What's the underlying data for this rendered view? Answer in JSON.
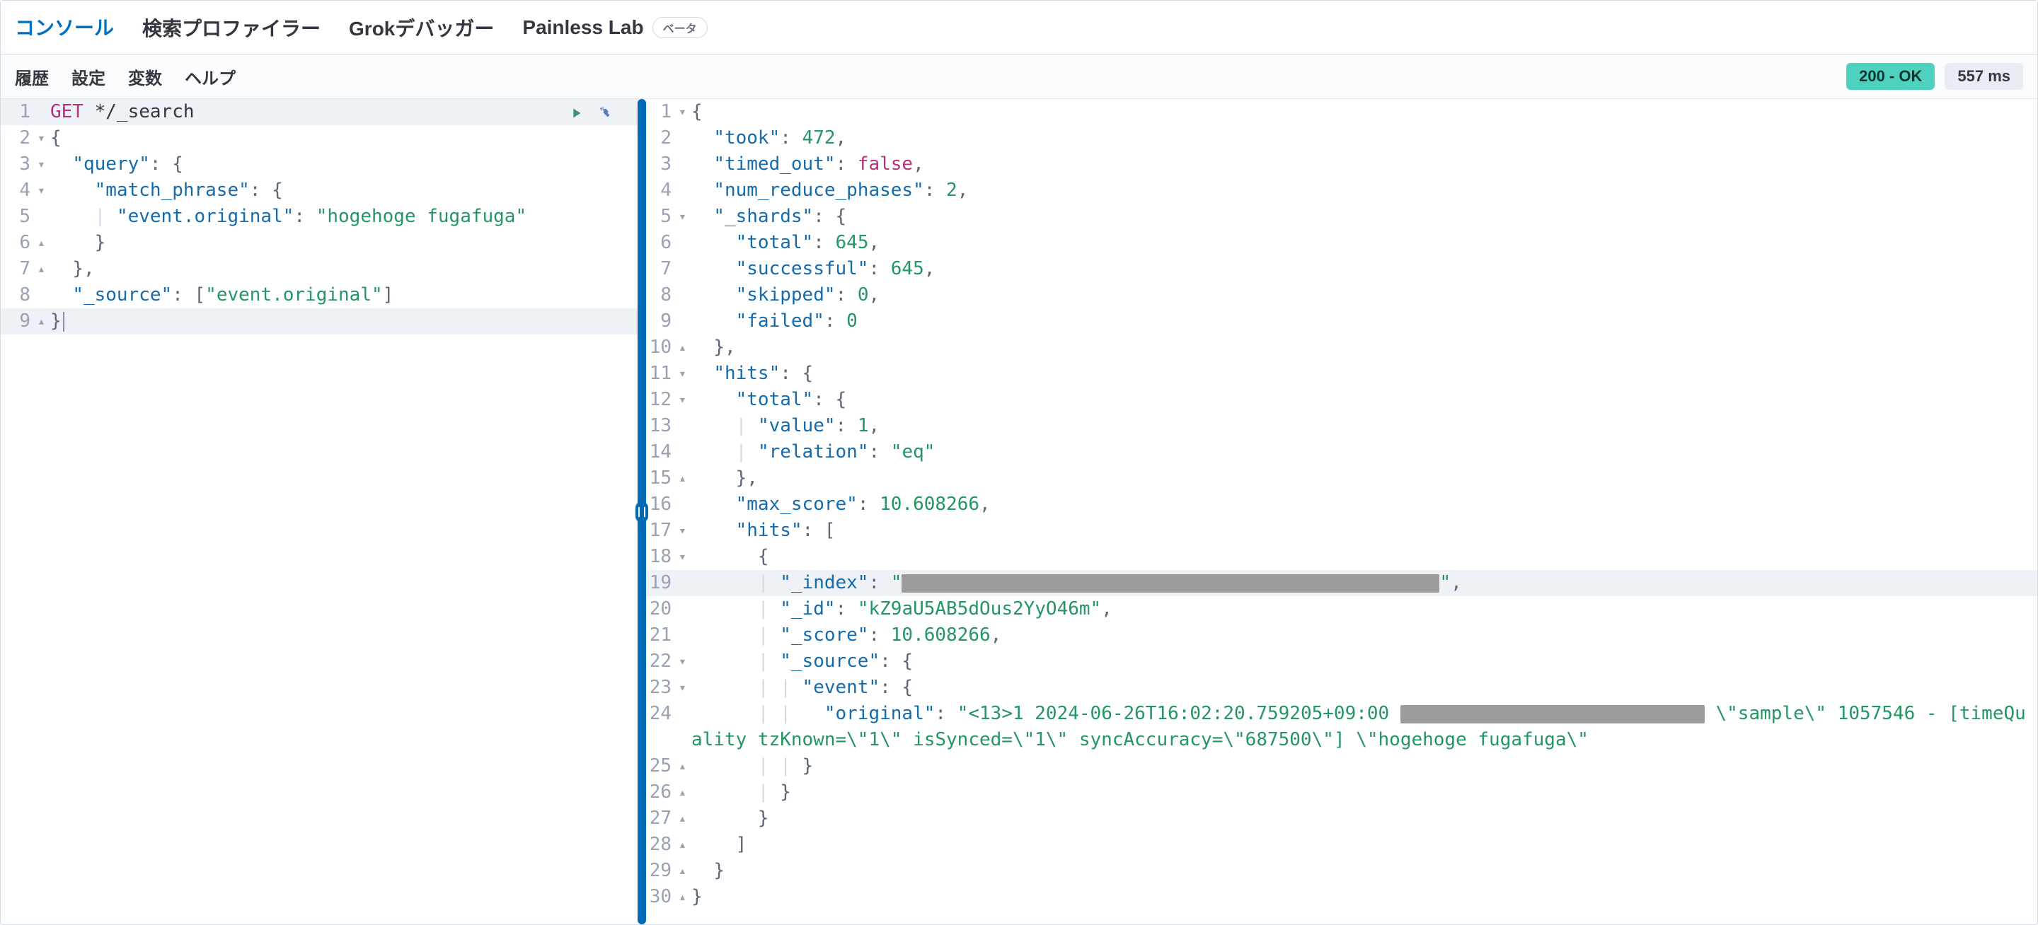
{
  "tabs": {
    "items": [
      {
        "label": "コンソール",
        "active": true
      },
      {
        "label": "検索プロファイラー",
        "active": false
      },
      {
        "label": "Grokデバッガー",
        "active": false
      },
      {
        "label": "Painless Lab",
        "active": false,
        "badge": "ベータ"
      }
    ]
  },
  "subnav": {
    "items": [
      "履歴",
      "設定",
      "変数",
      "ヘルプ"
    ]
  },
  "status": {
    "http": "200 - OK",
    "time": "557 ms"
  },
  "request": {
    "method": "GET",
    "path": "*/_search",
    "body": {
      "query": {
        "match_phrase": {
          "event.original": "hogehoge fugafuga"
        }
      },
      "_source": [
        "event.original"
      ]
    },
    "lines": [
      {
        "n": 1,
        "fold": "",
        "hl": true,
        "tokens": [
          [
            "k-method",
            "GET"
          ],
          [
            "k-plain",
            " "
          ],
          [
            "k-plain",
            "*/_search"
          ]
        ]
      },
      {
        "n": 2,
        "fold": "▾",
        "hl": false,
        "tokens": [
          [
            "k-punc",
            "{"
          ]
        ]
      },
      {
        "n": 3,
        "fold": "▾",
        "hl": false,
        "tokens": [
          [
            "k-plain",
            "  "
          ],
          [
            "k-key",
            "\"query\""
          ],
          [
            "k-punc",
            ": {"
          ]
        ]
      },
      {
        "n": 4,
        "fold": "▾",
        "hl": false,
        "tokens": [
          [
            "k-plain",
            "    "
          ],
          [
            "k-key",
            "\"match_phrase\""
          ],
          [
            "k-punc",
            ": {"
          ]
        ]
      },
      {
        "n": 5,
        "fold": "",
        "hl": false,
        "tokens": [
          [
            "k-plain",
            "    "
          ],
          [
            "guide",
            "| "
          ],
          [
            "k-key",
            "\"event.original\""
          ],
          [
            "k-punc",
            ": "
          ],
          [
            "k-str",
            "\"hogehoge fugafuga\""
          ]
        ]
      },
      {
        "n": 6,
        "fold": "▴",
        "hl": false,
        "tokens": [
          [
            "k-plain",
            "    "
          ],
          [
            "k-punc",
            "}"
          ]
        ]
      },
      {
        "n": 7,
        "fold": "▴",
        "hl": false,
        "tokens": [
          [
            "k-plain",
            "  "
          ],
          [
            "k-punc",
            "},"
          ]
        ]
      },
      {
        "n": 8,
        "fold": "",
        "hl": false,
        "tokens": [
          [
            "k-plain",
            "  "
          ],
          [
            "k-key",
            "\"_source\""
          ],
          [
            "k-punc",
            ": ["
          ],
          [
            "k-str",
            "\"event.original\""
          ],
          [
            "k-punc",
            "]"
          ]
        ]
      },
      {
        "n": 9,
        "fold": "▴",
        "hl": true,
        "tokens": [
          [
            "k-punc",
            "}"
          ],
          [
            "cursor",
            ""
          ]
        ]
      }
    ]
  },
  "response": {
    "data": {
      "took": 472,
      "timed_out": false,
      "num_reduce_phases": 2,
      "_shards": {
        "total": 645,
        "successful": 645,
        "skipped": 0,
        "failed": 0
      },
      "hits": {
        "total": {
          "value": 1,
          "relation": "eq"
        },
        "max_score": 10.608266,
        "hits": [
          {
            "_index": "[redacted]",
            "_id": "kZ9aU5AB5dOus2YyO46m",
            "_score": 10.608266,
            "_source": {
              "event": {
                "original": "<13>1 2024-06-26T16:02:20.759205+09:00 [redacted] \\\"sample\\\" 1057546 - [timeQuality tzKnown=\\\"1\\\" isSynced=\\\"1\\\" syncAccuracy=\\\"687500\\\"] \\\"hogehoge fugafuga\\\""
              }
            }
          }
        ]
      }
    },
    "lines": [
      {
        "n": 1,
        "fold": "▾",
        "tokens": [
          [
            "k-punc",
            "{"
          ]
        ]
      },
      {
        "n": 2,
        "fold": "",
        "tokens": [
          [
            "k-plain",
            "  "
          ],
          [
            "k-key",
            "\"took\""
          ],
          [
            "k-punc",
            ": "
          ],
          [
            "k-num",
            "472"
          ],
          [
            "k-punc",
            ","
          ]
        ]
      },
      {
        "n": 3,
        "fold": "",
        "tokens": [
          [
            "k-plain",
            "  "
          ],
          [
            "k-key",
            "\"timed_out\""
          ],
          [
            "k-punc",
            ": "
          ],
          [
            "k-bool",
            "false"
          ],
          [
            "k-punc",
            ","
          ]
        ]
      },
      {
        "n": 4,
        "fold": "",
        "tokens": [
          [
            "k-plain",
            "  "
          ],
          [
            "k-key",
            "\"num_reduce_phases\""
          ],
          [
            "k-punc",
            ": "
          ],
          [
            "k-num",
            "2"
          ],
          [
            "k-punc",
            ","
          ]
        ]
      },
      {
        "n": 5,
        "fold": "▾",
        "tokens": [
          [
            "k-plain",
            "  "
          ],
          [
            "k-key",
            "\"_shards\""
          ],
          [
            "k-punc",
            ": {"
          ]
        ]
      },
      {
        "n": 6,
        "fold": "",
        "tokens": [
          [
            "k-plain",
            "    "
          ],
          [
            "k-key",
            "\"total\""
          ],
          [
            "k-punc",
            ": "
          ],
          [
            "k-num",
            "645"
          ],
          [
            "k-punc",
            ","
          ]
        ]
      },
      {
        "n": 7,
        "fold": "",
        "tokens": [
          [
            "k-plain",
            "    "
          ],
          [
            "k-key",
            "\"successful\""
          ],
          [
            "k-punc",
            ": "
          ],
          [
            "k-num",
            "645"
          ],
          [
            "k-punc",
            ","
          ]
        ]
      },
      {
        "n": 8,
        "fold": "",
        "tokens": [
          [
            "k-plain",
            "    "
          ],
          [
            "k-key",
            "\"skipped\""
          ],
          [
            "k-punc",
            ": "
          ],
          [
            "k-num",
            "0"
          ],
          [
            "k-punc",
            ","
          ]
        ]
      },
      {
        "n": 9,
        "fold": "",
        "tokens": [
          [
            "k-plain",
            "    "
          ],
          [
            "k-key",
            "\"failed\""
          ],
          [
            "k-punc",
            ": "
          ],
          [
            "k-num",
            "0"
          ]
        ]
      },
      {
        "n": 10,
        "fold": "▴",
        "tokens": [
          [
            "k-plain",
            "  "
          ],
          [
            "k-punc",
            "},"
          ]
        ]
      },
      {
        "n": 11,
        "fold": "▾",
        "tokens": [
          [
            "k-plain",
            "  "
          ],
          [
            "k-key",
            "\"hits\""
          ],
          [
            "k-punc",
            ": {"
          ]
        ]
      },
      {
        "n": 12,
        "fold": "▾",
        "tokens": [
          [
            "k-plain",
            "    "
          ],
          [
            "k-key",
            "\"total\""
          ],
          [
            "k-punc",
            ": {"
          ]
        ]
      },
      {
        "n": 13,
        "fold": "",
        "tokens": [
          [
            "k-plain",
            "    "
          ],
          [
            "guide",
            "| "
          ],
          [
            "k-key",
            "\"value\""
          ],
          [
            "k-punc",
            ": "
          ],
          [
            "k-num",
            "1"
          ],
          [
            "k-punc",
            ","
          ]
        ]
      },
      {
        "n": 14,
        "fold": "",
        "tokens": [
          [
            "k-plain",
            "    "
          ],
          [
            "guide",
            "| "
          ],
          [
            "k-key",
            "\"relation\""
          ],
          [
            "k-punc",
            ": "
          ],
          [
            "k-str",
            "\"eq\""
          ]
        ]
      },
      {
        "n": 15,
        "fold": "▴",
        "tokens": [
          [
            "k-plain",
            "    "
          ],
          [
            "k-punc",
            "},"
          ]
        ]
      },
      {
        "n": 16,
        "fold": "",
        "tokens": [
          [
            "k-plain",
            "    "
          ],
          [
            "k-key",
            "\"max_score\""
          ],
          [
            "k-punc",
            ": "
          ],
          [
            "k-num",
            "10.608266"
          ],
          [
            "k-punc",
            ","
          ]
        ]
      },
      {
        "n": 17,
        "fold": "▾",
        "tokens": [
          [
            "k-plain",
            "    "
          ],
          [
            "k-key",
            "\"hits\""
          ],
          [
            "k-punc",
            ": ["
          ]
        ]
      },
      {
        "n": 18,
        "fold": "▾",
        "tokens": [
          [
            "k-plain",
            "      "
          ],
          [
            "k-punc",
            "{"
          ]
        ]
      },
      {
        "n": 19,
        "fold": "",
        "hl": true,
        "tokens": [
          [
            "k-plain",
            "      "
          ],
          [
            "guide",
            "| "
          ],
          [
            "k-key",
            "\"_index\""
          ],
          [
            "k-punc",
            ": "
          ],
          [
            "k-str",
            "\""
          ],
          [
            "redact",
            "760"
          ],
          [
            "k-str",
            "\""
          ],
          [
            "k-punc",
            ","
          ]
        ]
      },
      {
        "n": 20,
        "fold": "",
        "tokens": [
          [
            "k-plain",
            "      "
          ],
          [
            "guide",
            "| "
          ],
          [
            "k-key",
            "\"_id\""
          ],
          [
            "k-punc",
            ": "
          ],
          [
            "k-str",
            "\"kZ9aU5AB5dOus2YyO46m\""
          ],
          [
            "k-punc",
            ","
          ]
        ]
      },
      {
        "n": 21,
        "fold": "",
        "tokens": [
          [
            "k-plain",
            "      "
          ],
          [
            "guide",
            "| "
          ],
          [
            "k-key",
            "\"_score\""
          ],
          [
            "k-punc",
            ": "
          ],
          [
            "k-num",
            "10.608266"
          ],
          [
            "k-punc",
            ","
          ]
        ]
      },
      {
        "n": 22,
        "fold": "▾",
        "tokens": [
          [
            "k-plain",
            "      "
          ],
          [
            "guide",
            "| "
          ],
          [
            "k-key",
            "\"_source\""
          ],
          [
            "k-punc",
            ": {"
          ]
        ]
      },
      {
        "n": 23,
        "fold": "▾",
        "tokens": [
          [
            "k-plain",
            "      "
          ],
          [
            "guide",
            "| | "
          ],
          [
            "k-key",
            "\"event\""
          ],
          [
            "k-punc",
            ": {"
          ]
        ]
      },
      {
        "n": 24,
        "fold": "",
        "tokens": [
          [
            "k-plain",
            "      "
          ],
          [
            "guide",
            "| |   "
          ],
          [
            "k-key",
            "\"original\""
          ],
          [
            "k-punc",
            ": "
          ],
          [
            "k-str",
            "\"<13>1 2024-06-26T16:02:20.759205+09:00 "
          ],
          [
            "redact",
            "430"
          ],
          [
            "k-str",
            " \\\"sample\\\" 1057546 - [timeQuality tzKnown=\\\"1\\\" isSynced=\\\"1\\\" syncAccuracy=\\\"687500\\\"] \\\"hogehoge fugafuga\\\""
          ]
        ]
      },
      {
        "n": 25,
        "fold": "▴",
        "tokens": [
          [
            "k-plain",
            "      "
          ],
          [
            "guide",
            "| | "
          ],
          [
            "k-punc",
            "}"
          ]
        ]
      },
      {
        "n": 26,
        "fold": "▴",
        "tokens": [
          [
            "k-plain",
            "      "
          ],
          [
            "guide",
            "| "
          ],
          [
            "k-punc",
            "}"
          ]
        ]
      },
      {
        "n": 27,
        "fold": "▴",
        "tokens": [
          [
            "k-plain",
            "      "
          ],
          [
            "k-punc",
            "}"
          ]
        ]
      },
      {
        "n": 28,
        "fold": "▴",
        "tokens": [
          [
            "k-plain",
            "    "
          ],
          [
            "k-punc",
            "]"
          ]
        ]
      },
      {
        "n": 29,
        "fold": "▴",
        "tokens": [
          [
            "k-plain",
            "  "
          ],
          [
            "k-punc",
            "}"
          ]
        ]
      },
      {
        "n": 30,
        "fold": "▴",
        "tokens": [
          [
            "k-punc",
            "}"
          ]
        ]
      }
    ]
  }
}
